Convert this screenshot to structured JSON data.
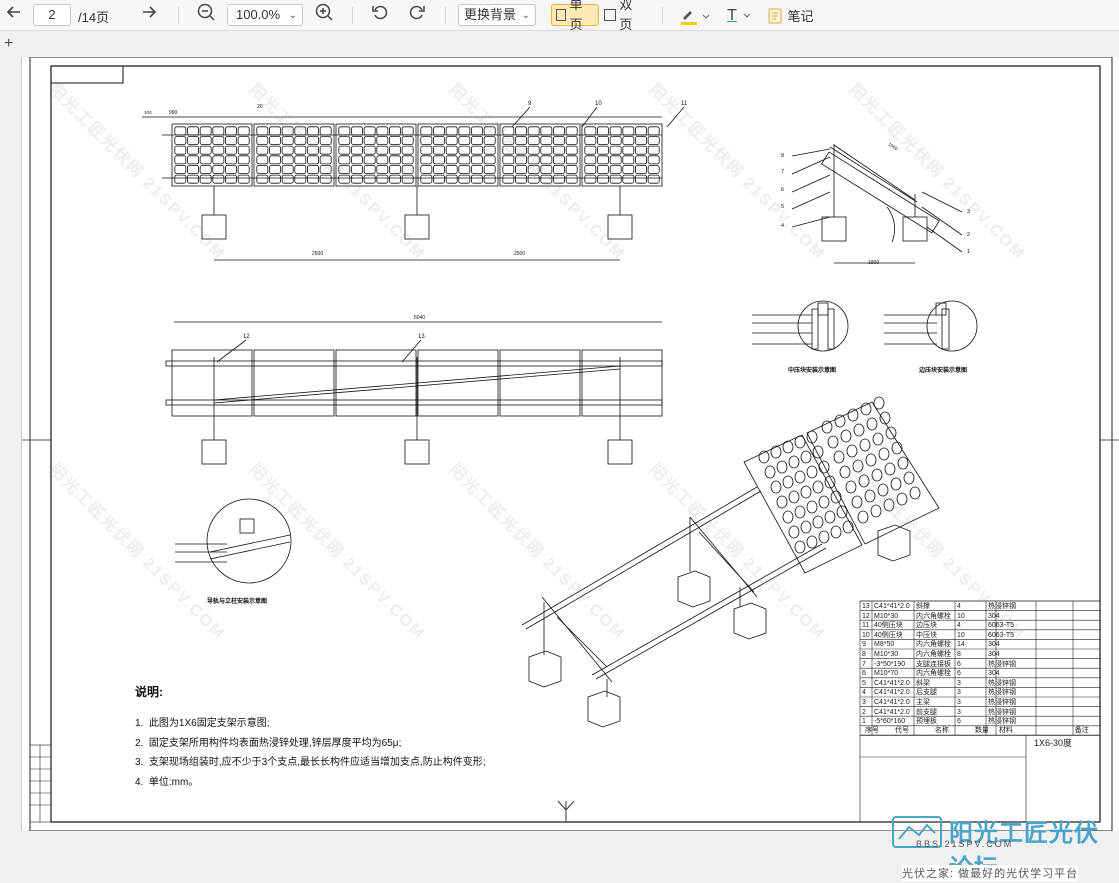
{
  "toolbar": {
    "current_page": "2",
    "total_pages": "/14页",
    "zoom": "100.0%",
    "background_label": "更换背景",
    "single_page_label": "单页",
    "double_page_label": "双页",
    "note_label": "笔记",
    "text_tool_label": "T",
    "colors": {
      "accent": "#fce9b5",
      "accent_border": "#e8b64a",
      "highlight": "#f4d000"
    }
  },
  "tabbar": {
    "add_symbol": "+"
  },
  "drawing": {
    "dims": {
      "top_width": "990",
      "top_offset": "100",
      "top_gap": "20",
      "span1": "2500",
      "span2": "2500",
      "plan_width": "6040",
      "side_base": "1800",
      "side_panel": "1960"
    },
    "callouts": {
      "c9": "9",
      "c10": "10",
      "c11": "11",
      "c12": "12",
      "c13": "13",
      "s1": "1",
      "s2": "2",
      "s3": "3",
      "s4": "4",
      "s5": "5",
      "s6": "6",
      "s7": "7",
      "s8": "8"
    },
    "captions": {
      "mid_clamp": "中压块安装示意图",
      "end_clamp": "边压块安装示意图",
      "rail": "导轨与立柱安装示意图"
    },
    "notes": {
      "title": "说明:",
      "items": [
        {
          "num": "1.",
          "text": "此图为1X6固定支架示意图;"
        },
        {
          "num": "2.",
          "text": "固定支架所用构件均表面热浸锌处理,锌层厚度平均为65μ;"
        },
        {
          "num": "3.",
          "text": "支架现场组装时,应不少于3个支点,最长长构件应适当增加支点,防止构件变形;"
        },
        {
          "num": "4.",
          "text": "单位:mm。"
        }
      ]
    },
    "bom": {
      "rows": [
        {
          "no": "13",
          "spec": "C41*41*2.0",
          "name": "斜撑",
          "qty": "4",
          "mat": "热浸锌钢",
          "remark": ""
        },
        {
          "no": "12",
          "spec": "M10*30",
          "name": "内六角螺栓",
          "qty": "10",
          "mat": "304",
          "remark": ""
        },
        {
          "no": "11",
          "spec": "40侧压块",
          "name": "边压块",
          "qty": "4",
          "mat": "6063-T5",
          "remark": ""
        },
        {
          "no": "10",
          "spec": "40侧压块",
          "name": "中压块",
          "qty": "10",
          "mat": "6063-T5",
          "remark": ""
        },
        {
          "no": "9",
          "spec": "M8*50",
          "name": "内六角螺栓",
          "qty": "14",
          "mat": "304",
          "remark": ""
        },
        {
          "no": "8",
          "spec": "M10*30",
          "name": "内六角螺栓",
          "qty": "8",
          "mat": "304",
          "remark": ""
        },
        {
          "no": "7",
          "spec": "-3*50*190",
          "name": "支腿连接板",
          "qty": "6",
          "mat": "热浸锌钢",
          "remark": ""
        },
        {
          "no": "6",
          "spec": "M10*70",
          "name": "内六角螺栓",
          "qty": "6",
          "mat": "304",
          "remark": ""
        },
        {
          "no": "5",
          "spec": "C41*41*2.0",
          "name": "斜梁",
          "qty": "3",
          "mat": "热浸锌钢",
          "remark": ""
        },
        {
          "no": "4",
          "spec": "C41*41*2.0",
          "name": "后支腿",
          "qty": "3",
          "mat": "热浸锌钢",
          "remark": ""
        },
        {
          "no": "3",
          "spec": "C41*41*2.0",
          "name": "主梁",
          "qty": "3",
          "mat": "热浸锌钢",
          "remark": ""
        },
        {
          "no": "2",
          "spec": "C41*41*2.0",
          "name": "前支腿",
          "qty": "3",
          "mat": "热浸锌钢",
          "remark": ""
        },
        {
          "no": "1",
          "spec": "-5*60*160",
          "name": "预埋板",
          "qty": "6",
          "mat": "热浸锌钢",
          "remark": ""
        }
      ],
      "header": {
        "no": "序号",
        "spec": "代号",
        "name": "名称",
        "qty": "数量",
        "mat": "材料",
        "remark": "备注"
      }
    },
    "title_block": {
      "drawing_name": "1X6-30度"
    },
    "watermark": "阳光工匠光伏网 21SPV.COM"
  },
  "logo": {
    "text": "阳光工匠光伏论坛",
    "sub": "BBS.21SPV.COM",
    "tagline": "光伏之家: 做最好的光伏学习平台"
  }
}
